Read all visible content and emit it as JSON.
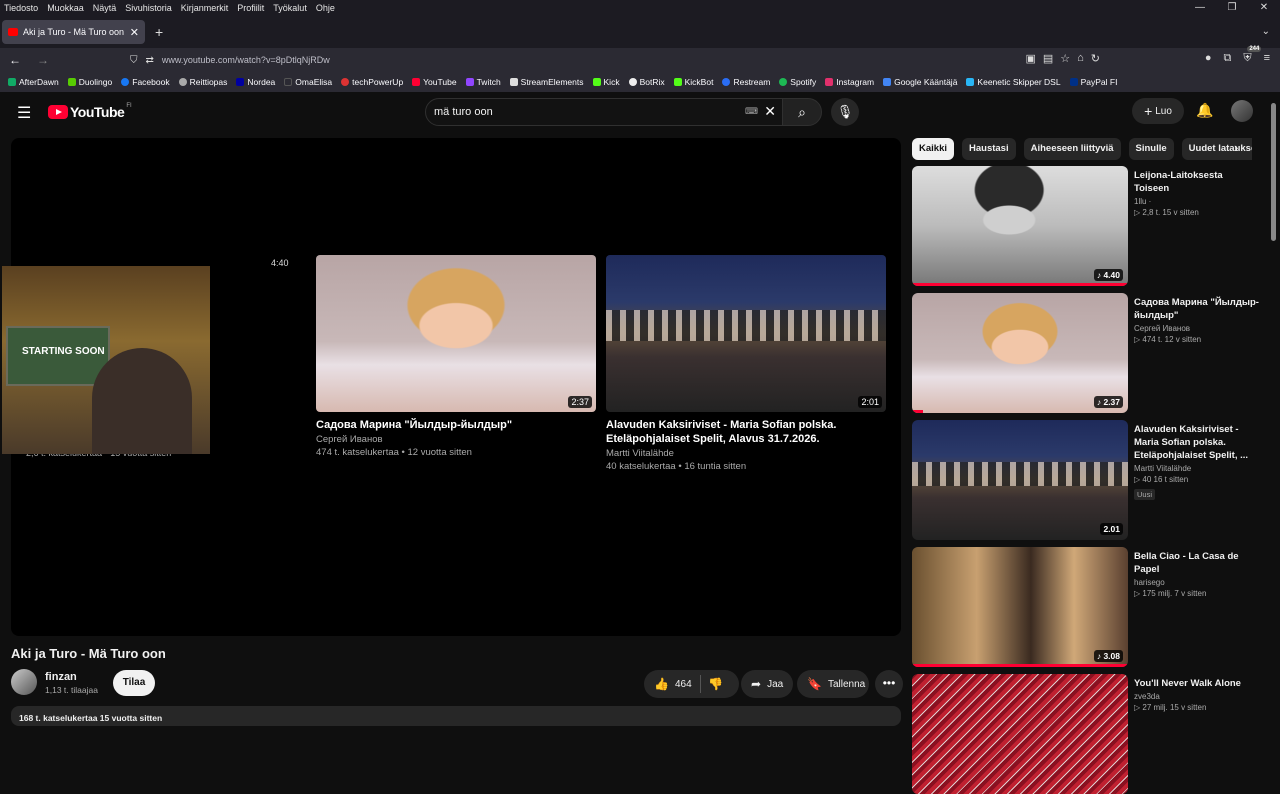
{
  "menubar": [
    "Tiedosto",
    "Muokkaa",
    "Näytä",
    "Sivuhistoria",
    "Kirjanmerkit",
    "Profiilit",
    "Työkalut",
    "Ohje"
  ],
  "tab": {
    "title": "Aki ja Turo - Mä Turo oon - YouTube"
  },
  "url": "www.youtube.com/watch?v=8pDtlqNjRDw",
  "extension_badge": "244",
  "bookmarks": [
    "AfterDawn",
    "Duolingo",
    "Facebook",
    "Reittiopas",
    "Nordea",
    "OmaElisa",
    "techPowerUp",
    "YouTube",
    "Twitch",
    "StreamElements",
    "Kick",
    "BotRix",
    "KickBot",
    "Restream",
    "Spotify",
    "Instagram",
    "Google Kääntäjä",
    "Keenetic Skipper DSL",
    "PayPal FI"
  ],
  "youtube": {
    "logo": "YouTube",
    "region": "FI",
    "search_value": "mä turo oon",
    "create_label": "Luo"
  },
  "player": {
    "left_card_duration": "4:40",
    "left_card_meta": "2,6 t. katselukertaa • 15 vuotta sitten",
    "webcam_caption": "STARTING SOON",
    "endcards": [
      {
        "title": "Садова Марина \"Йылдыр-йылдыр\"",
        "channel": "Сергей Иванов",
        "meta": "474 t. katselukertaa • 12 vuotta sitten",
        "duration": "2:37"
      },
      {
        "title": "Alavuden Kaksiriviset - Maria Sofian polska. Eteläpohjalaiset Spelit, Alavus 31.7.2026.",
        "channel": "Martti Viitalähde",
        "meta": "40 katselukertaa • 16 tuntia sitten",
        "duration": "2:01"
      }
    ]
  },
  "video": {
    "title": "Aki ja Turo - Mä Turo oon",
    "channel": "finzan",
    "subscribers": "1,13 t. tilaajaa",
    "subscribe_label": "Tilaa",
    "likes": "464",
    "share_label": "Jaa",
    "save_label": "Tallenna",
    "description_meta": "168 t. katselukertaa  15 vuotta sitten"
  },
  "chips": [
    "Kaikki",
    "Haustasi",
    "Aiheeseen liittyviä",
    "Sinulle",
    "Uudet lataukset"
  ],
  "recommendations": [
    {
      "title": "Leijona-Laitoksesta Toiseen",
      "channel": "1llu",
      "views": "2,8 t.",
      "age": "15 v sitten",
      "duration": "4.40",
      "progress": 1.0
    },
    {
      "title": "Садова Марина \"Йылдыр-йылдыр\"",
      "channel": "Сергей Иванов",
      "views": "474 t.",
      "age": "12 v sitten",
      "duration": "2.37",
      "progress": 0.05
    },
    {
      "title": "Alavuden Kaksiriviset - Maria Sofian polska. Eteläpohjalaiset Spelit, ...",
      "channel": "Martti Viitalähde",
      "views": "40",
      "age": "16 t sitten",
      "duration": "2.01",
      "badge": "Uusi",
      "progress": 0
    },
    {
      "title": "Bella Ciao - La Casa de Papel",
      "channel": "harisego",
      "views": "175 milj.",
      "age": "7 v sitten",
      "duration": "3.08",
      "progress": 1.0
    },
    {
      "title": "You'll Never Walk Alone",
      "channel": "zve3da",
      "views": "27 milj.",
      "age": "15 v sitten",
      "duration": "",
      "progress": 0
    }
  ],
  "colors": {
    "youtube_red": "#ff0033",
    "background": "#0f0f0f"
  }
}
